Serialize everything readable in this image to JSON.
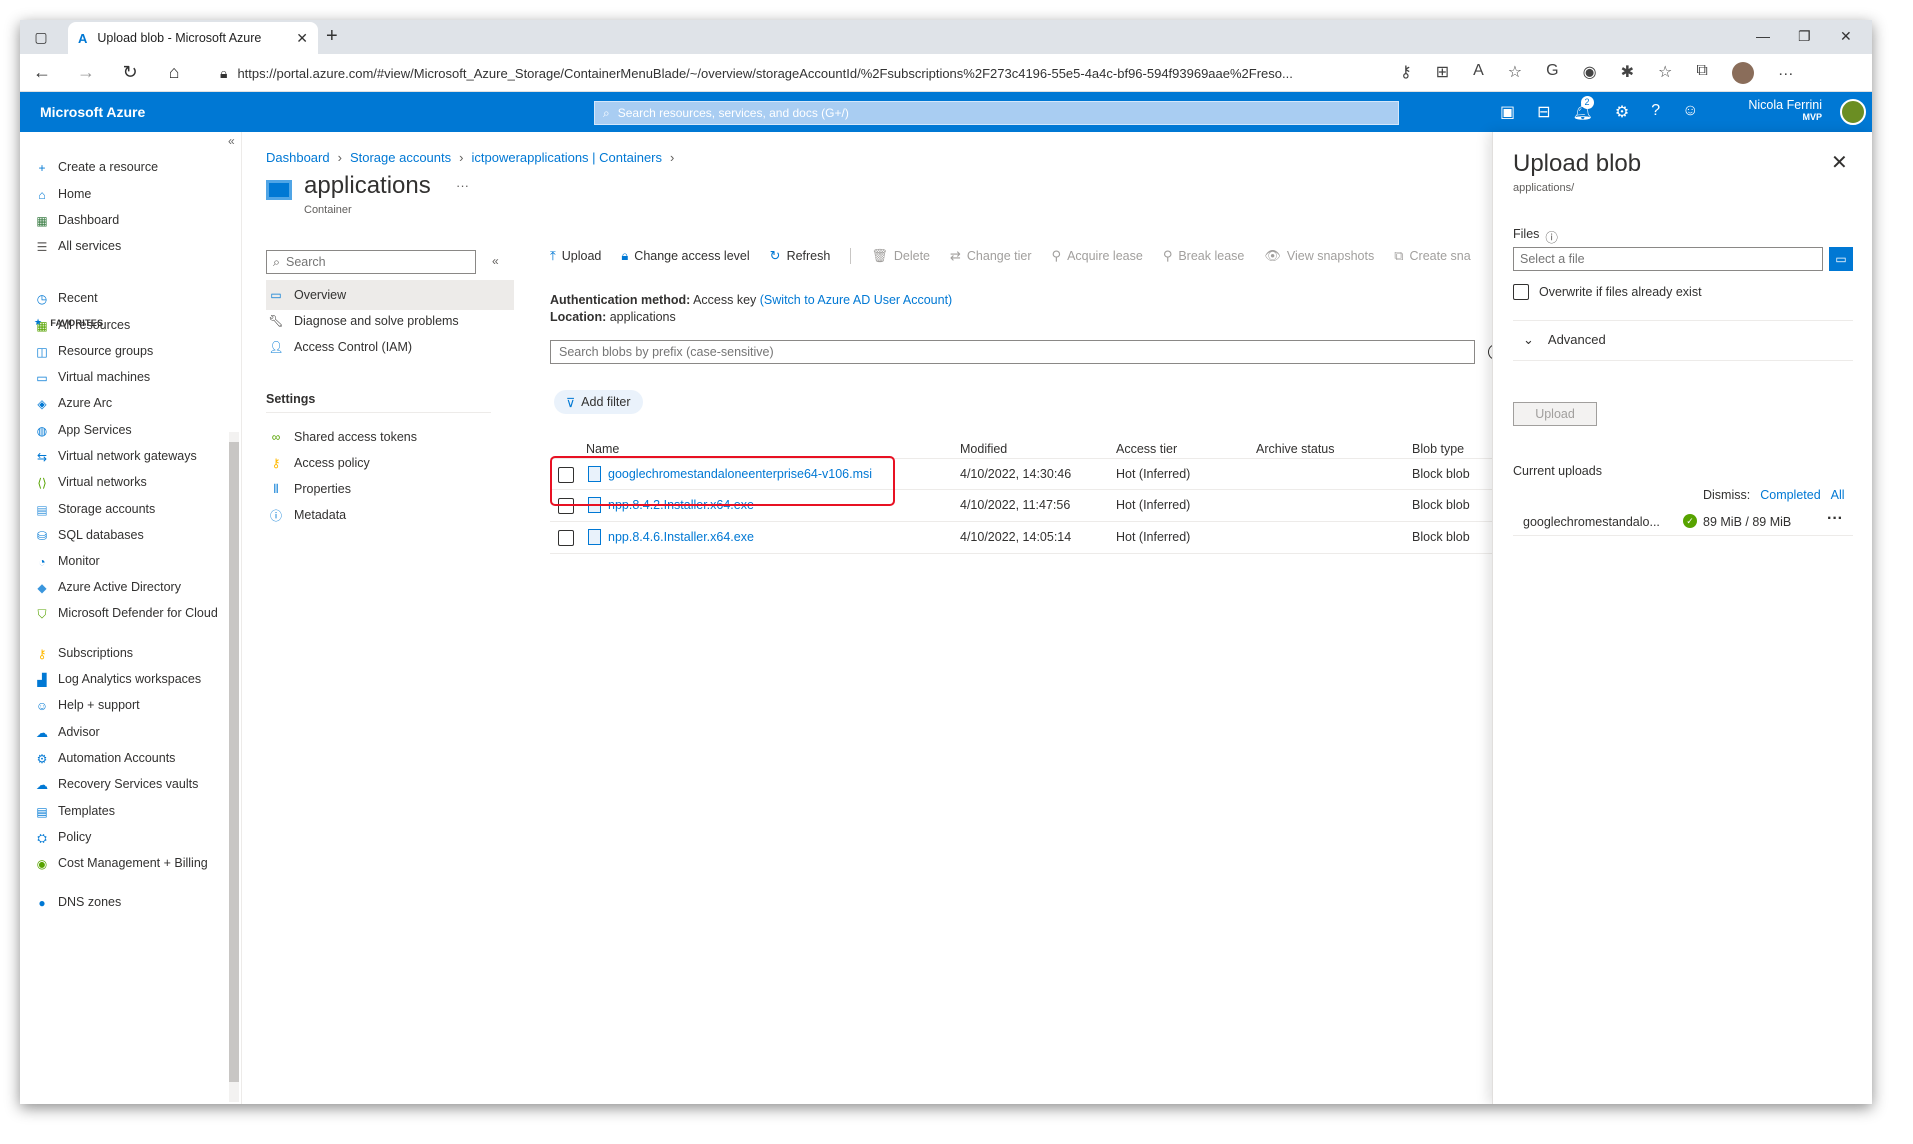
{
  "browser": {
    "tab_title": "Upload blob - Microsoft Azure",
    "url": "https://portal.azure.com/#view/Microsoft_Azure_Storage/ContainerMenuBlade/~/overview/storageAccountId/%2Fsubscriptions%2F273c4196-55e5-4a4c-bf96-594f93969aae%2Freso..."
  },
  "header": {
    "brand": "Microsoft Azure",
    "search_placeholder": "Search resources, services, and docs (G+/)",
    "notifications_count": "2",
    "user_name": "Nicola Ferrini",
    "user_tag": "MVP"
  },
  "sidebar": {
    "favorites_label": "FAVORITES",
    "items": [
      {
        "label": "Create a resource",
        "icon": "plus-icon",
        "color": "#0078d4"
      },
      {
        "label": "Home",
        "icon": "home-icon",
        "color": "#0078d4"
      },
      {
        "label": "Dashboard",
        "icon": "dashboard-icon",
        "color": "#3a7d44"
      },
      {
        "label": "All services",
        "icon": "list-icon",
        "color": "#605e5c"
      },
      {
        "label": "Recent",
        "icon": "clock-icon",
        "color": "#0078d4"
      },
      {
        "label": "All resources",
        "icon": "grid-icon",
        "color": "#57a300"
      },
      {
        "label": "Resource groups",
        "icon": "resource-group-icon",
        "color": "#0078d4"
      },
      {
        "label": "Virtual machines",
        "icon": "vm-icon",
        "color": "#0078d4"
      },
      {
        "label": "Azure Arc",
        "icon": "arc-icon",
        "color": "#0078d4"
      },
      {
        "label": "App Services",
        "icon": "app-service-icon",
        "color": "#0078d4"
      },
      {
        "label": "Virtual network gateways",
        "icon": "gateway-icon",
        "color": "#0078d4"
      },
      {
        "label": "Virtual networks",
        "icon": "vnet-icon",
        "color": "#57a300"
      },
      {
        "label": "Storage accounts",
        "icon": "storage-icon",
        "color": "#3a96dd"
      },
      {
        "label": "SQL databases",
        "icon": "sql-icon",
        "color": "#0078d4"
      },
      {
        "label": "Monitor",
        "icon": "monitor-icon",
        "color": "#0078d4"
      },
      {
        "label": "Azure Active Directory",
        "icon": "aad-icon",
        "color": "#3a96dd"
      },
      {
        "label": "Microsoft Defender for Cloud",
        "icon": "shield-icon",
        "color": "#57a300"
      },
      {
        "label": "Subscriptions",
        "icon": "key-icon",
        "color": "#ffb900"
      },
      {
        "label": "Log Analytics workspaces",
        "icon": "analytics-icon",
        "color": "#0078d4"
      },
      {
        "label": "Help + support",
        "icon": "support-icon",
        "color": "#0078d4"
      },
      {
        "label": "Advisor",
        "icon": "advisor-icon",
        "color": "#0078d4"
      },
      {
        "label": "Automation Accounts",
        "icon": "gear-icon",
        "color": "#0078d4"
      },
      {
        "label": "Recovery Services vaults",
        "icon": "cloud-icon",
        "color": "#0078d4"
      },
      {
        "label": "Templates",
        "icon": "template-icon",
        "color": "#0078d4"
      },
      {
        "label": "Policy",
        "icon": "policy-icon",
        "color": "#0078d4"
      },
      {
        "label": "Cost Management + Billing",
        "icon": "cost-icon",
        "color": "#57a300"
      },
      {
        "label": "DNS zones",
        "icon": "dns-icon",
        "color": "#0078d4"
      }
    ]
  },
  "breadcrumb": [
    "Dashboard",
    "Storage accounts",
    "ictpowerapplications | Containers"
  ],
  "page": {
    "title": "applications",
    "subtitle": "Container"
  },
  "blade_menu": {
    "search_placeholder": "Search",
    "items": [
      {
        "label": "Overview",
        "icon": "overview-icon"
      },
      {
        "label": "Diagnose and solve problems",
        "icon": "wrench-icon"
      },
      {
        "label": "Access Control (IAM)",
        "icon": "people-icon"
      }
    ],
    "settings_label": "Settings",
    "settings_items": [
      {
        "label": "Shared access tokens",
        "icon": "link-icon"
      },
      {
        "label": "Access policy",
        "icon": "key-icon"
      },
      {
        "label": "Properties",
        "icon": "properties-icon"
      },
      {
        "label": "Metadata",
        "icon": "info-icon"
      }
    ]
  },
  "toolbar": {
    "upload": "Upload",
    "change_access": "Change access level",
    "refresh": "Refresh",
    "delete": "Delete",
    "change_tier": "Change tier",
    "acquire_lease": "Acquire lease",
    "break_lease": "Break lease",
    "view_snapshots": "View snapshots",
    "create_snapshot": "Create sna"
  },
  "auth": {
    "method_label": "Authentication method:",
    "method_value": "Access key",
    "switch_link": "(Switch to Azure AD User Account)",
    "location_label": "Location:",
    "location_value": "applications"
  },
  "prefix_placeholder": "Search blobs by prefix (case-sensitive)",
  "add_filter": "Add filter",
  "grid": {
    "columns": [
      "Name",
      "Modified",
      "Access tier",
      "Archive status",
      "Blob type"
    ],
    "rows": [
      {
        "name": "googlechromestandaloneenterprise64-v106.msi",
        "modified": "4/10/2022, 14:30:46",
        "tier": "Hot (Inferred)",
        "archive": "",
        "type": "Block blob"
      },
      {
        "name": "npp.8.4.2.Installer.x64.exe",
        "modified": "4/10/2022, 11:47:56",
        "tier": "Hot (Inferred)",
        "archive": "",
        "type": "Block blob"
      },
      {
        "name": "npp.8.4.6.Installer.x64.exe",
        "modified": "4/10/2022, 14:05:14",
        "tier": "Hot (Inferred)",
        "archive": "",
        "type": "Block blob"
      }
    ]
  },
  "panel": {
    "title": "Upload blob",
    "subtitle": "applications/",
    "files_label": "Files",
    "file_placeholder": "Select a file",
    "overwrite": "Overwrite if files already exist",
    "advanced": "Advanced",
    "upload_button": "Upload",
    "current_uploads": "Current uploads",
    "dismiss_label": "Dismiss:",
    "dismiss_completed": "Completed",
    "dismiss_all": "All",
    "upload_item": {
      "name": "googlechromestandalo...",
      "size": "89 MiB / 89 MiB"
    }
  },
  "colors": {
    "azure_blue": "#0078d4",
    "highlight_red": "#e81123"
  }
}
